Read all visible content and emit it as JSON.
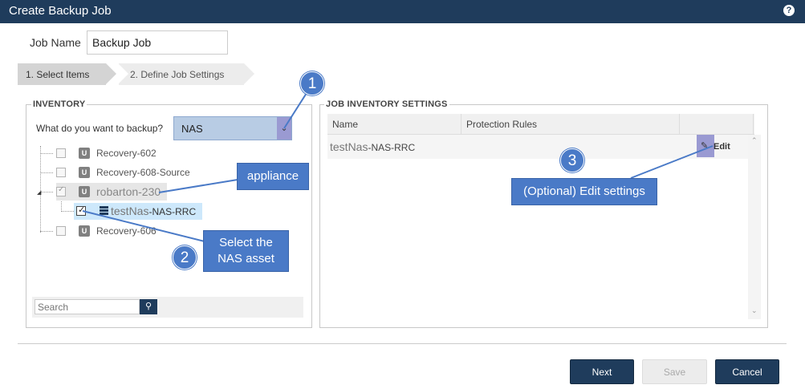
{
  "window": {
    "title": "Create Backup Job",
    "help_icon": "question-circle-icon"
  },
  "form": {
    "job_name_label": "Job Name",
    "job_name_value": "Backup Job"
  },
  "steps": [
    {
      "label": "1. Select Items",
      "active": true
    },
    {
      "label": "2. Define Job Settings",
      "active": false
    }
  ],
  "inventory": {
    "legend": "INVENTORY",
    "question": "What do you want to backup?",
    "backup_type": "NAS",
    "tree": [
      {
        "label": "Recovery-602",
        "checked": false
      },
      {
        "label": "Recovery-608-Source",
        "checked": false
      },
      {
        "label": "robarton-230",
        "checked": true
      },
      {
        "label_main": "testNas",
        "label_suffix": "-NAS-RRC",
        "checked": true
      },
      {
        "label": "Recovery-606",
        "checked": false
      }
    ],
    "search_placeholder": "Search",
    "search_icon": "search-icon"
  },
  "job_inventory": {
    "legend": "JOB INVENTORY SETTINGS",
    "columns": [
      "Name",
      "Protection Rules"
    ],
    "rows": [
      {
        "name_main": "testNas",
        "name_suffix": "-NAS-RRC",
        "protection": "",
        "edit_label": "Edit"
      }
    ]
  },
  "buttons": {
    "next": "Next",
    "save": "Save",
    "cancel": "Cancel"
  },
  "annotations": {
    "c1": "1",
    "c2": "2",
    "c3": "3",
    "appliance": "appliance",
    "select_nas_line1": "Select the",
    "select_nas_line2": "NAS asset",
    "edit_settings": "(Optional) Edit settings"
  },
  "colors": {
    "titlebar": "#1f3c5c",
    "callout": "#4a7ac7",
    "select_bg": "#b8cce4",
    "highlight": "#9a9ad2"
  }
}
